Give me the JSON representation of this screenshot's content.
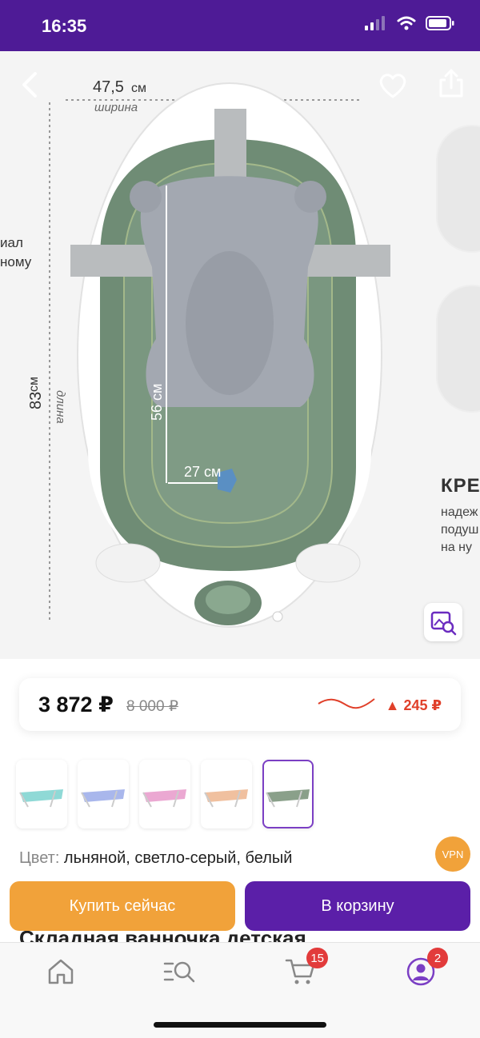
{
  "status_bar": {
    "time": "16:35"
  },
  "gallery": {
    "dimensions": {
      "width_value": "47,5",
      "width_unit": "см",
      "width_label": "ширина",
      "length_value": "83",
      "length_unit": "см",
      "length_label": "длина",
      "inner_length": "56 см",
      "inner_width": "27 см"
    },
    "left_cut_text": [
      "иал",
      "ному"
    ],
    "side_title": "КРЕ",
    "side_lines": [
      "надеж",
      "подуш",
      "на ну"
    ]
  },
  "price": {
    "current": "3 872 ₽",
    "old": "8 000 ₽",
    "delta": "▲ 245 ₽",
    "trend_color": "#e0402a"
  },
  "thumbnails": [
    {
      "color": "#8fd9d6"
    },
    {
      "color": "#a9b7ec"
    },
    {
      "color": "#eba8d2"
    },
    {
      "color": "#f0c09f"
    },
    {
      "color": "#8aa08a"
    }
  ],
  "color_info": {
    "label": "Цвет:",
    "value": " льняной, светло-серый, белый"
  },
  "vpn_badge": "VPN",
  "product_title_peek": "Складная ванночка детская",
  "buttons": {
    "buy_now": "Купить сейчас",
    "add_to_cart": "В корзину"
  },
  "tab_bar": {
    "cart_count": "15",
    "profile_count": "2"
  },
  "colors": {
    "brand_purple": "#5b1fa8",
    "accent_orange": "#f1a23a",
    "badge_red": "#e23b3b"
  }
}
